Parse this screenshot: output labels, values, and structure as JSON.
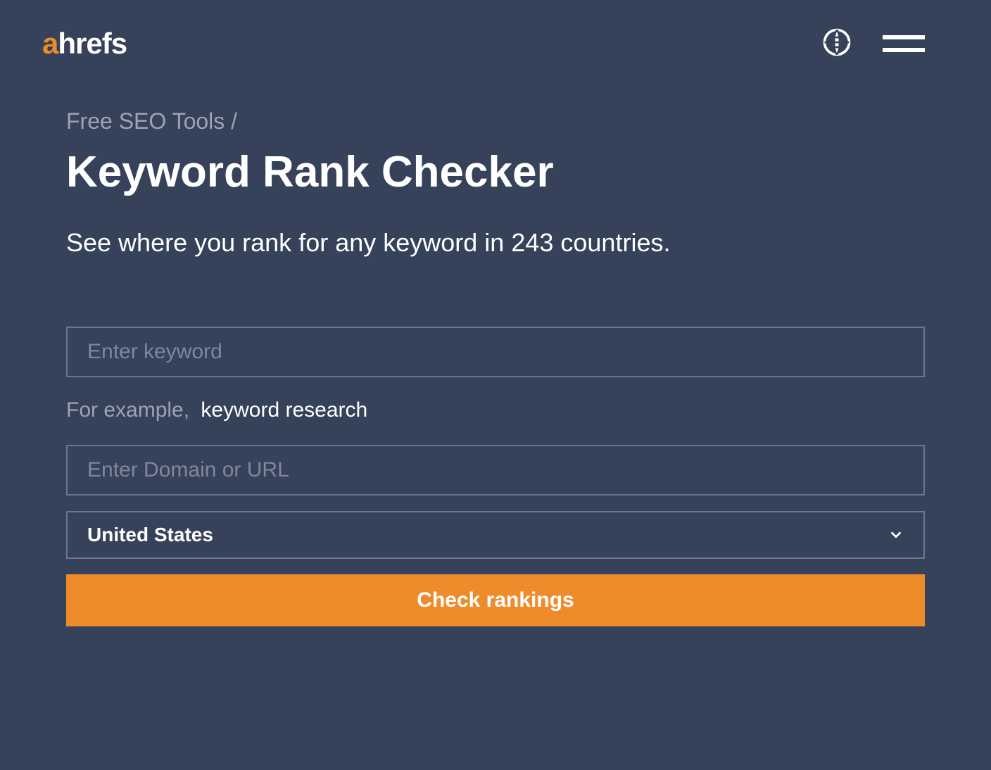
{
  "header": {
    "logo_part1": "a",
    "logo_part2": "hrefs"
  },
  "main": {
    "breadcrumb": "Free SEO Tools /",
    "title": "Keyword Rank Checker",
    "subtitle": "See where you rank for any keyword in 243 countries.",
    "keyword_input": {
      "placeholder": "Enter keyword",
      "value": ""
    },
    "example": {
      "label": "For example,",
      "value": "keyword research"
    },
    "domain_input": {
      "placeholder": "Enter Domain or URL",
      "value": ""
    },
    "country_select": {
      "selected": "United States"
    },
    "submit_button": "Check rankings"
  }
}
